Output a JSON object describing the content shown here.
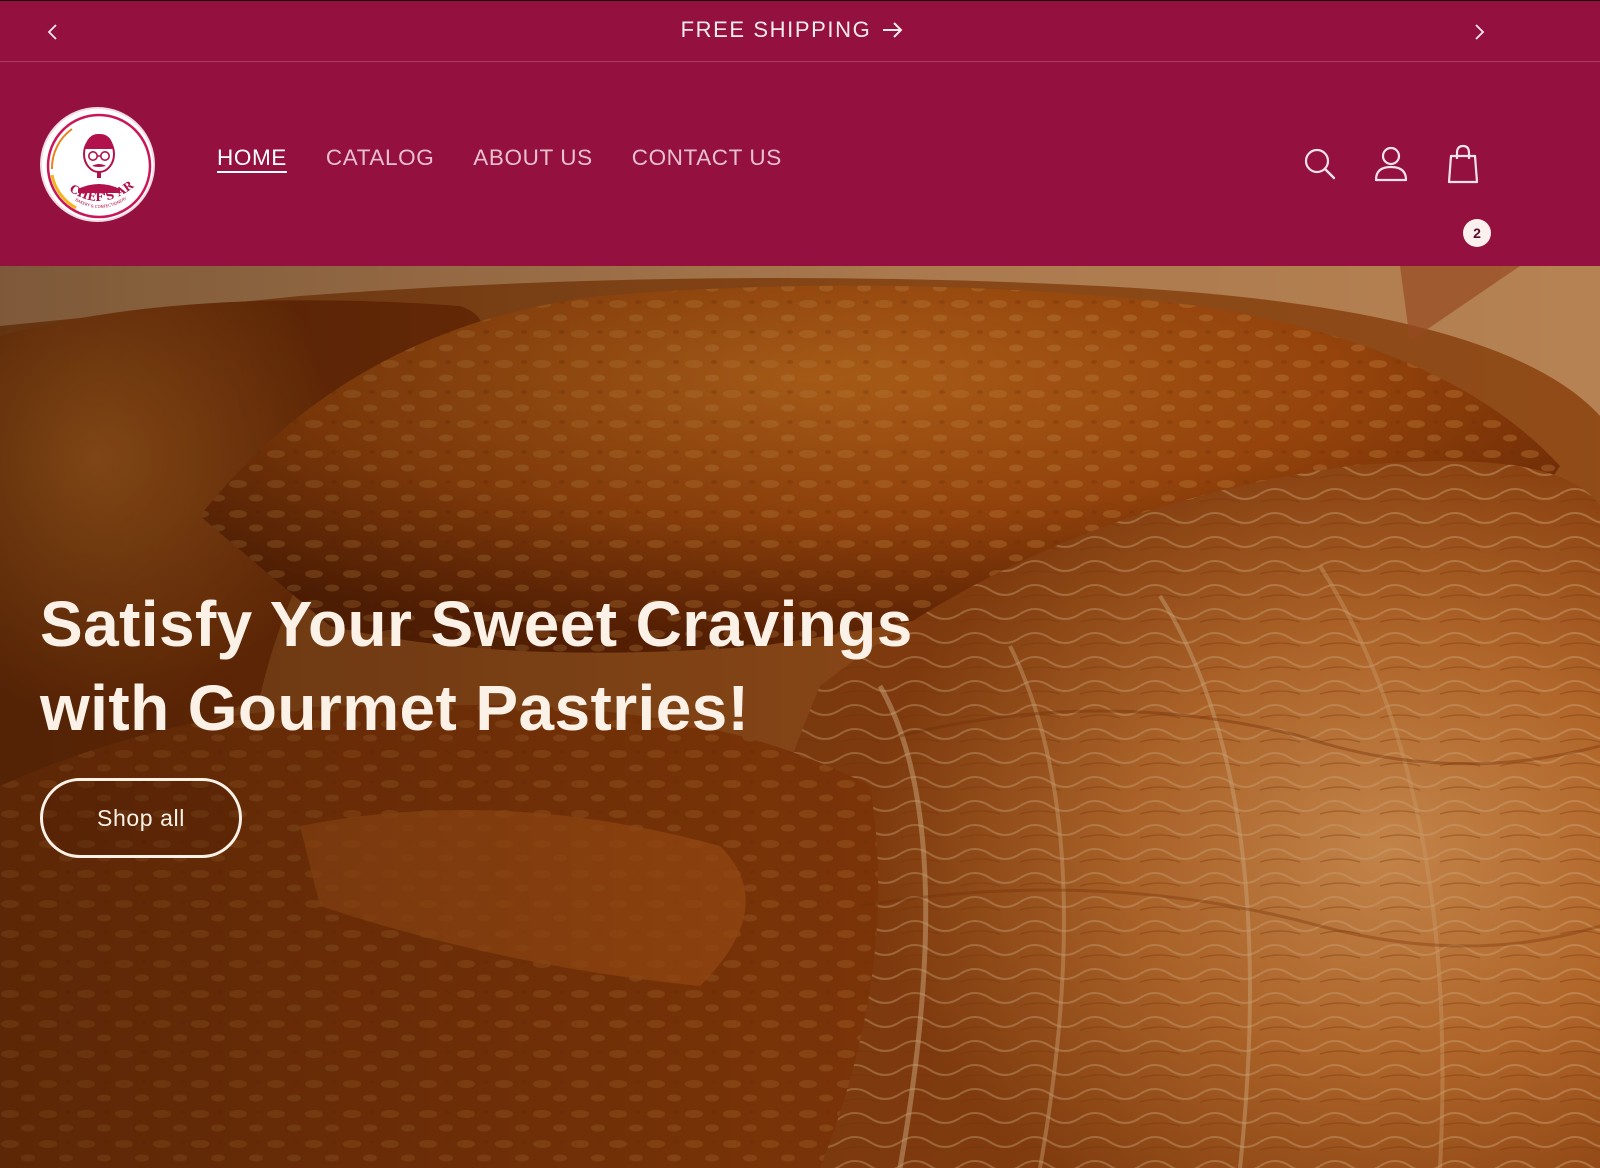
{
  "announcement": {
    "text": "FREE SHIPPING",
    "prev_icon": "chevron-left-icon",
    "next_icon": "chevron-right-icon",
    "arrow_icon": "arrow-right-icon"
  },
  "brand": {
    "name": "CHEF'S ART"
  },
  "nav": {
    "items": [
      {
        "label": "HOME",
        "active": true
      },
      {
        "label": "CATALOG",
        "active": false
      },
      {
        "label": "ABOUT US",
        "active": false
      },
      {
        "label": "CONTACT US",
        "active": false
      }
    ]
  },
  "header_icons": {
    "search": "search-icon",
    "account": "account-icon",
    "cart": "cart-icon",
    "cart_count": "2"
  },
  "hero": {
    "title_line1": "Satisfy Your Sweet Cravings",
    "title_line2": "with Gourmet Pastries!",
    "button_label": "Shop all",
    "image": "croissant-closeup"
  },
  "colors": {
    "brand": "#93103f",
    "text_light": "#fbf1e6",
    "pastry": "#c8651a"
  }
}
